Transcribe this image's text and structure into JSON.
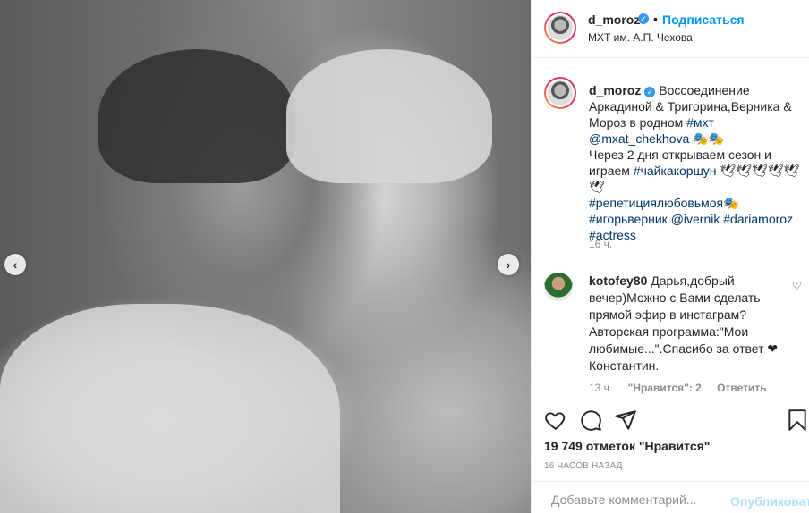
{
  "photo": {
    "alt_icon_prev": "chevron-left-icon",
    "alt_icon_next": "chevron-right-icon",
    "prev_glyph": "‹",
    "next_glyph": "›"
  },
  "header": {
    "username": "d_moroz",
    "dot": "•",
    "follow_label": "Подписаться",
    "location": "МХТ им. А.П. Чехова"
  },
  "caption": {
    "username": "d_moroz",
    "text1": "Воссоединение Аркадиной & Тригорина,Верника & Мороз в родном ",
    "tag1": "#мхт",
    "tag2": "@mxat_chekhova",
    "emoji1": " 🎭🎭",
    "text2": "Через 2 дня открываем сезон и играем ",
    "tag3": "#чайкакоршун",
    "emoji2": " 🕊🕊🕊🕊🕊🕊",
    "tag4": "#репетициялюбовьмоя",
    "emoji3": "🎭",
    "tag5": "#игорьверник",
    "tag6": "@ivernik",
    "tag7": "#dariamoroz",
    "tag8": "#actress",
    "time": "16 ч."
  },
  "comment": {
    "username": "kotofey80",
    "text": "Дарья,добрый вечер)Можно с Вами сделать прямой эфир в инстаграм? Авторская программа:\"Мои любимые...\".Спасибо за ответ ❤ Константин.",
    "time": "13 ч.",
    "likes": "\"Нравится\": 2",
    "reply": "Ответить"
  },
  "actions": {
    "like_icon": "heart-icon",
    "comment_icon": "comment-icon",
    "share_icon": "share-icon",
    "save_icon": "bookmark-icon"
  },
  "likes_text": "19 749 отметок \"Нравится\"",
  "post_age": "16 ЧАСОВ НАЗАД",
  "comment_box": {
    "placeholder": "Добавьте комментарий...",
    "publish_label": "Опубликовать"
  }
}
